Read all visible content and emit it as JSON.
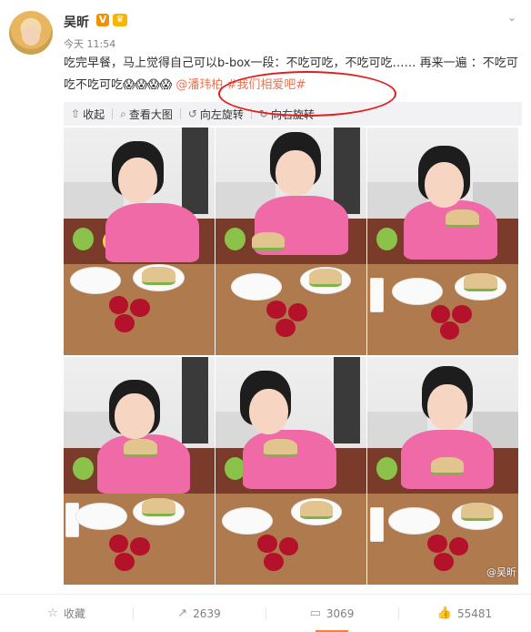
{
  "header": {
    "username": "吴昕",
    "v_badge": "V",
    "crown_badge": "♛",
    "time": "今天 11:54",
    "menu_icon": "chevron-down-icon"
  },
  "content": {
    "text_1": "吃完早餐，马上觉得自己可以b-box一段：不吃可吃，不吃可吃…… 再来一遍 ：不吃可吃不吃可吃",
    "emojis": "😱😱😱😱",
    "mention": "@潘玮柏",
    "tag": "#我们相爱吧#"
  },
  "media_toolbar": {
    "collapse": "收起",
    "view_large": "查看大图",
    "rotate_left": "向左旋转",
    "rotate_right": "向右旋转"
  },
  "watermark": "@吴昕",
  "bottom_bar": {
    "favorite": "收藏",
    "repost_count": "2639",
    "comment_count": "3069",
    "like_count": "55481"
  },
  "colors": {
    "link": "#eb7350",
    "annotation": "#e02020",
    "active_indicator": "#fa7d3c"
  }
}
